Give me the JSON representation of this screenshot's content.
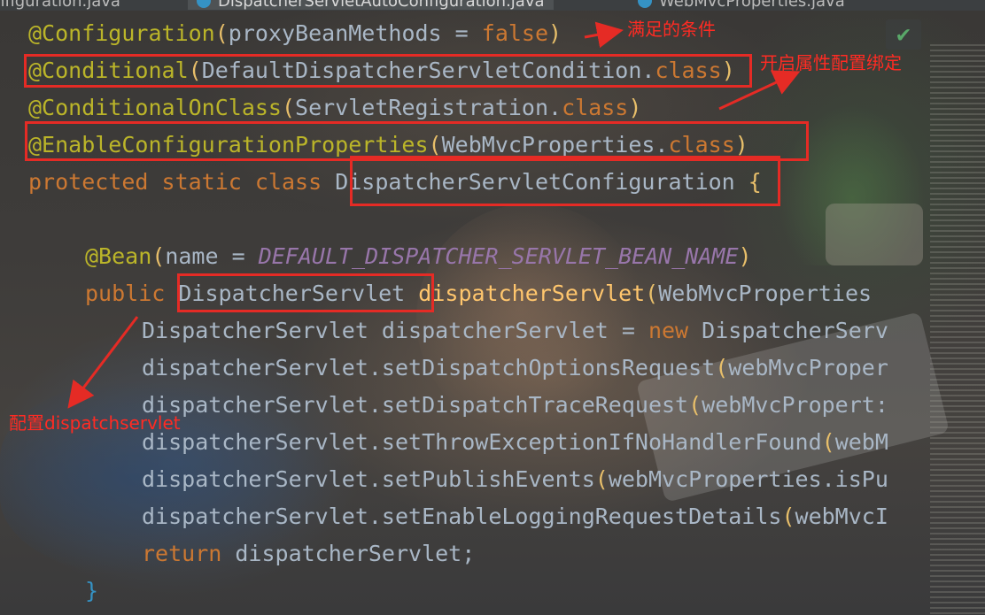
{
  "tabs": [
    {
      "label": "nfiguration.java",
      "active": false
    },
    {
      "label": "DispatcherServletAutoConfiguration.java",
      "active": true
    },
    {
      "label": "WebMvcProperties.java",
      "active": false
    }
  ],
  "code": {
    "l1": {
      "ann": "@Configuration",
      "p1": "(",
      "body": "proxyBeanMethods = ",
      "kw": "false",
      "p2": ")"
    },
    "l2": {
      "ann": "@Conditional",
      "p1": "(",
      "cls": "DefaultDispatcherServletCondition.",
      "kw": "class",
      "p2": ")"
    },
    "l3": {
      "ann": "@ConditionalOnClass",
      "p1": "(",
      "cls": "ServletRegistration.",
      "kw": "class",
      "p2": ")"
    },
    "l4": {
      "ann": "@EnableConfigurationProperties",
      "p1": "(",
      "cls": "WebMvcProperties.",
      "kw": "class",
      "p2": ")"
    },
    "l5": {
      "kw": "protected static class ",
      "cls": "DispatcherServletConfiguration",
      "brace": " {"
    },
    "l6": {
      "ann": "@Bean",
      "p1": "(",
      "body": "name = ",
      "const": "DEFAULT_DISPATCHER_SERVLET_BEAN_NAME",
      "p2": ")"
    },
    "l7": {
      "kw": "public ",
      "cls": "DispatcherServlet",
      "space": " ",
      "fn": "dispatcherServlet",
      "p1": "(",
      "rest": "WebMvcProperties "
    },
    "l8": {
      "body": "DispatcherServlet dispatcherServlet = ",
      "kw": "new ",
      "rest": "DispatcherServ"
    },
    "l9": {
      "body": "dispatcherServlet.setDispatchOptionsRequest",
      "p1": "(",
      "rest": "webMvcProper"
    },
    "l10": {
      "body": "dispatcherServlet.setDispatchTraceRequest",
      "p1": "(",
      "rest": "webMvcPropert:"
    },
    "l11": {
      "body": "dispatcherServlet.setThrowExceptionIfNoHandlerFound",
      "p1": "(",
      "rest": "webM"
    },
    "l12": {
      "body": "dispatcherServlet.setPublishEvents",
      "p1": "(",
      "rest": "webMvcProperties.isPu"
    },
    "l13": {
      "body": "dispatcherServlet.setEnableLoggingRequestDetails",
      "p1": "(",
      "rest": "webMvcI"
    },
    "l14": {
      "kw": "return ",
      "body": "dispatcherServlet;"
    },
    "l15": {
      "brace": "}"
    }
  },
  "notes": {
    "conditions": "满足的条件",
    "binding": "开启属性配置绑定",
    "configure": "配置dispatchservlet"
  },
  "colors": {
    "annotation": "#bbb529",
    "keyword": "#cc7832",
    "text": "#a9b7c6",
    "constant": "#9876aa",
    "method": "#ffc66d",
    "redbox": "#e52b25"
  },
  "icons": {
    "inspection": "check-icon",
    "tab": "java-class-icon"
  }
}
